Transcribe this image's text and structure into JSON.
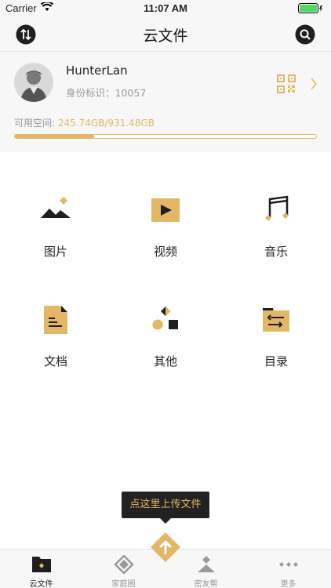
{
  "status_bar": {
    "carrier": "Carrier",
    "time": "11:07 AM"
  },
  "nav": {
    "title": "云文件",
    "left_icon": "sort-icon",
    "right_icon": "search-icon"
  },
  "profile": {
    "name": "HunterLan",
    "id_label": "身份标识：",
    "id_value": "10057",
    "space_label": "可用空间: ",
    "space_value": "245.74GB/931.48GB",
    "space_used_fraction": 0.2638
  },
  "categories": [
    {
      "label": "图片",
      "icon": "image-icon"
    },
    {
      "label": "视频",
      "icon": "video-icon"
    },
    {
      "label": "音乐",
      "icon": "music-icon"
    },
    {
      "label": "文档",
      "icon": "document-icon"
    },
    {
      "label": "其他",
      "icon": "other-icon"
    },
    {
      "label": "目录",
      "icon": "folder-icon"
    }
  ],
  "upload_tooltip": "点这里上传文件",
  "tabs": [
    {
      "label": "云文件",
      "active": true
    },
    {
      "label": "家庭圈",
      "active": false
    },
    {
      "label": "密友帮",
      "active": false
    },
    {
      "label": "更多",
      "active": false
    }
  ],
  "colors": {
    "accent": "#e3b766",
    "dark": "#222222",
    "muted": "#999999"
  }
}
